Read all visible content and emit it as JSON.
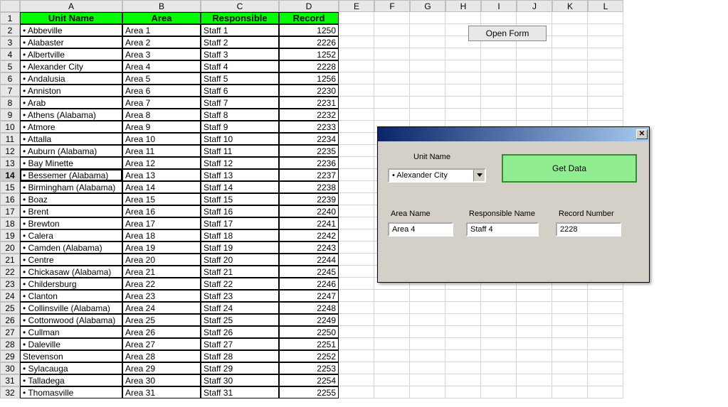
{
  "columns": [
    "A",
    "B",
    "C",
    "D",
    "E",
    "F",
    "G",
    "H",
    "I",
    "J",
    "K",
    "L"
  ],
  "headers": {
    "unit": "Unit Name",
    "area": "Area",
    "resp": "Responsible",
    "rec": "Record"
  },
  "selectedRow": 14,
  "rows": [
    {
      "n": 2,
      "unit": "• Abbeville",
      "area": "Area 1",
      "resp": "Staff 1",
      "rec": "1250"
    },
    {
      "n": 3,
      "unit": "• Alabaster",
      "area": "Area 2",
      "resp": "Staff 2",
      "rec": "2226"
    },
    {
      "n": 4,
      "unit": "• Albertville",
      "area": "Area 3",
      "resp": "Staff 3",
      "rec": "1252"
    },
    {
      "n": 5,
      "unit": "• Alexander City",
      "area": "Area 4",
      "resp": "Staff 4",
      "rec": "2228"
    },
    {
      "n": 6,
      "unit": "• Andalusia",
      "area": "Area 5",
      "resp": "Staff 5",
      "rec": "1256"
    },
    {
      "n": 7,
      "unit": "• Anniston",
      "area": "Area 6",
      "resp": "Staff 6",
      "rec": "2230"
    },
    {
      "n": 8,
      "unit": "• Arab",
      "area": "Area 7",
      "resp": "Staff 7",
      "rec": "2231"
    },
    {
      "n": 9,
      "unit": "• Athens (Alabama)",
      "area": "Area 8",
      "resp": "Staff 8",
      "rec": "2232"
    },
    {
      "n": 10,
      "unit": "• Atmore",
      "area": "Area 9",
      "resp": "Staff 9",
      "rec": "2233"
    },
    {
      "n": 11,
      "unit": "• Attalla",
      "area": "Area 10",
      "resp": "Staff 10",
      "rec": "2234"
    },
    {
      "n": 12,
      "unit": "• Auburn (Alabama)",
      "area": "Area 11",
      "resp": "Staff 11",
      "rec": "2235"
    },
    {
      "n": 13,
      "unit": "• Bay Minette",
      "area": "Area 12",
      "resp": "Staff 12",
      "rec": "2236"
    },
    {
      "n": 14,
      "unit": "• Bessemer (Alabama)",
      "area": "Area 13",
      "resp": "Staff 13",
      "rec": "2237"
    },
    {
      "n": 15,
      "unit": "• Birmingham (Alabama)",
      "area": "Area 14",
      "resp": "Staff 14",
      "rec": "2238"
    },
    {
      "n": 16,
      "unit": "• Boaz",
      "area": "Area 15",
      "resp": "Staff 15",
      "rec": "2239"
    },
    {
      "n": 17,
      "unit": "• Brent",
      "area": "Area 16",
      "resp": "Staff 16",
      "rec": "2240"
    },
    {
      "n": 18,
      "unit": "• Brewton",
      "area": "Area 17",
      "resp": "Staff 17",
      "rec": "2241"
    },
    {
      "n": 19,
      "unit": "• Calera",
      "area": "Area 18",
      "resp": "Staff 18",
      "rec": "2242"
    },
    {
      "n": 20,
      "unit": "• Camden (Alabama)",
      "area": "Area 19",
      "resp": "Staff 19",
      "rec": "2243"
    },
    {
      "n": 21,
      "unit": "• Centre",
      "area": "Area 20",
      "resp": "Staff 20",
      "rec": "2244"
    },
    {
      "n": 22,
      "unit": "• Chickasaw (Alabama)",
      "area": "Area 21",
      "resp": "Staff 21",
      "rec": "2245"
    },
    {
      "n": 23,
      "unit": "• Childersburg",
      "area": "Area 22",
      "resp": "Staff 22",
      "rec": "2246"
    },
    {
      "n": 24,
      "unit": "• Clanton",
      "area": "Area 23",
      "resp": "Staff 23",
      "rec": "2247"
    },
    {
      "n": 25,
      "unit": "• Collinsville (Alabama)",
      "area": "Area 24",
      "resp": "Staff 24",
      "rec": "2248"
    },
    {
      "n": 26,
      "unit": "• Cottonwood (Alabama)",
      "area": "Area 25",
      "resp": "Staff 25",
      "rec": "2249"
    },
    {
      "n": 27,
      "unit": "• Cullman",
      "area": "Area 26",
      "resp": "Staff 26",
      "rec": "2250"
    },
    {
      "n": 28,
      "unit": "• Daleville",
      "area": "Area 27",
      "resp": "Staff 27",
      "rec": "2251"
    },
    {
      "n": 29,
      "unit": "  Stevenson",
      "area": "Area 28",
      "resp": "Staff 28",
      "rec": "2252"
    },
    {
      "n": 30,
      "unit": "• Sylacauga",
      "area": "Area 29",
      "resp": "Staff 29",
      "rec": "2253"
    },
    {
      "n": 31,
      "unit": "• Talladega",
      "area": "Area 30",
      "resp": "Staff 30",
      "rec": "2254"
    },
    {
      "n": 32,
      "unit": "• Thomasville",
      "area": "Area 31",
      "resp": "Staff 31",
      "rec": "2255"
    }
  ],
  "openFormBtn": "Open Form",
  "form": {
    "unitNameLabel": "Unit Name",
    "comboValue": "• Alexander City",
    "getDataLabel": "Get Data",
    "areaLabel": "Area Name",
    "respLabel": "Responsible Name",
    "recLabel": "Record Number",
    "areaValue": "Area 4",
    "respValue": "Staff 4",
    "recValue": "2228",
    "closeGlyph": "✕"
  }
}
